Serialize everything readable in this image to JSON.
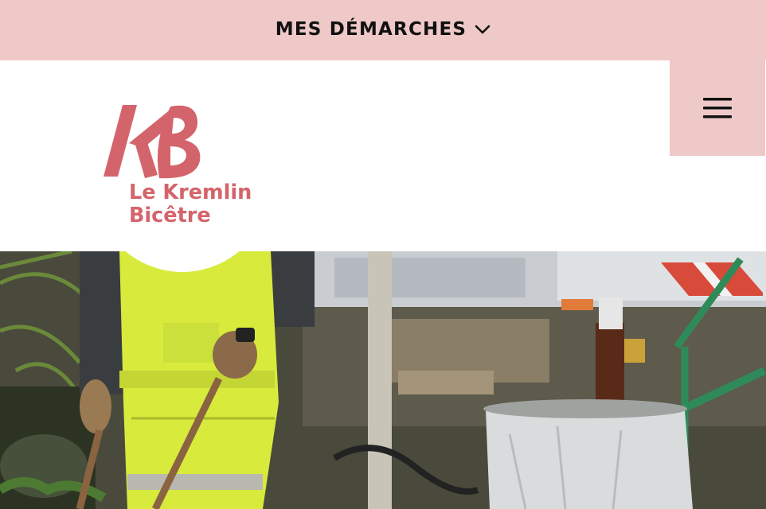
{
  "topbar": {
    "menu_label": "MES DÉMARCHES",
    "chevron_icon": "chevron-down-icon"
  },
  "header": {
    "menu_icon": "hamburger-menu-icon",
    "logo": {
      "monogram": "KB",
      "line1": "Le Kremlin",
      "line2": "Bicêtre"
    }
  },
  "hero": {
    "image": "photo-municipal-worker-cleaning-street-with-truck-and-trash-bin"
  },
  "colors": {
    "pink_bar": "#efc9c8",
    "logo_red": "#d4646b",
    "text_dark": "#111111"
  }
}
